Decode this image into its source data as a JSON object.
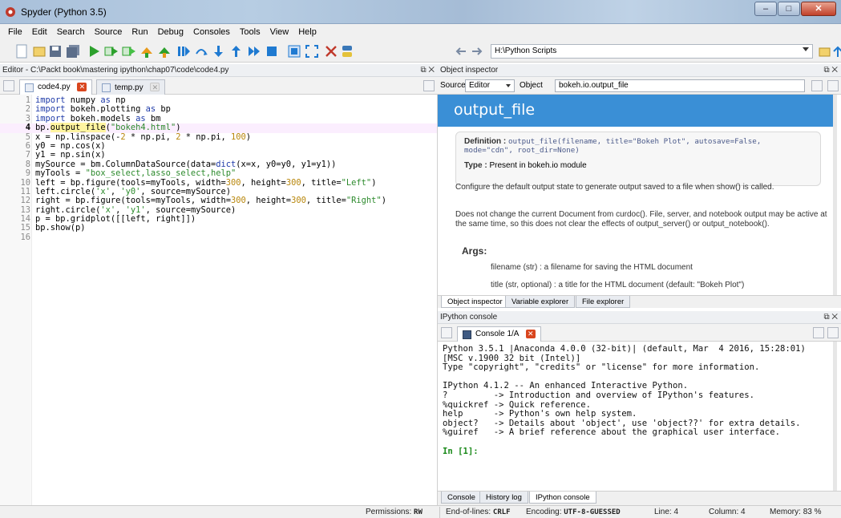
{
  "window": {
    "title": "Spyder (Python 3.5)"
  },
  "menu": [
    "File",
    "Edit",
    "Search",
    "Source",
    "Run",
    "Debug",
    "Consoles",
    "Tools",
    "View",
    "Help"
  ],
  "toolbar": {
    "path": "H:\\Python Scripts"
  },
  "editor": {
    "title": "Editor - C:\\Packt book\\mastering ipython\\chap07\\code\\code4.py",
    "tabs": [
      {
        "label": "code4.py",
        "active": true
      },
      {
        "label": "temp.py",
        "active": false
      }
    ],
    "current_line": 4
  },
  "code": [
    {
      "n": "1",
      "segs": [
        [
          "kw",
          "import"
        ],
        [
          "t",
          " numpy "
        ],
        [
          "kw",
          "as"
        ],
        [
          "t",
          " np"
        ]
      ]
    },
    {
      "n": "2",
      "segs": [
        [
          "kw",
          "import"
        ],
        [
          "t",
          " bokeh.plotting "
        ],
        [
          "kw",
          "as"
        ],
        [
          "t",
          " bp"
        ]
      ]
    },
    {
      "n": "3",
      "segs": [
        [
          "kw",
          "import"
        ],
        [
          "t",
          " bokeh.models "
        ],
        [
          "kw",
          "as"
        ],
        [
          "t",
          " bm"
        ]
      ]
    },
    {
      "n": "4",
      "segs": [
        [
          "t",
          "bp."
        ],
        [
          "hl",
          "output_file"
        ],
        [
          "t",
          "("
        ],
        [
          "str",
          "\"bokeh4.html\""
        ],
        [
          "t",
          ")"
        ]
      ]
    },
    {
      "n": "5",
      "segs": [
        [
          "t",
          "x = np.linspace(-"
        ],
        [
          "num",
          "2"
        ],
        [
          "t",
          " * np.pi, "
        ],
        [
          "num",
          "2"
        ],
        [
          "t",
          " * np.pi, "
        ],
        [
          "num",
          "100"
        ],
        [
          "t",
          ")"
        ]
      ]
    },
    {
      "n": "6",
      "segs": [
        [
          "t",
          "y0 = np.cos(x)"
        ]
      ]
    },
    {
      "n": "7",
      "segs": [
        [
          "t",
          "y1 = np.sin(x)"
        ]
      ]
    },
    {
      "n": "8",
      "segs": [
        [
          "t",
          "mySource = bm.ColumnDataSource(data="
        ],
        [
          "kw",
          "dict"
        ],
        [
          "t",
          "(x=x, y0=y0, y1=y1))"
        ]
      ]
    },
    {
      "n": "9",
      "segs": [
        [
          "t",
          "myTools = "
        ],
        [
          "str",
          "\"box_select,lasso_select,help\""
        ]
      ]
    },
    {
      "n": "10",
      "segs": [
        [
          "t",
          "left = bp.figure(tools=myTools, width="
        ],
        [
          "num",
          "300"
        ],
        [
          "t",
          ", height="
        ],
        [
          "num",
          "300"
        ],
        [
          "t",
          ", title="
        ],
        [
          "str",
          "\"Left\""
        ],
        [
          "t",
          ")"
        ]
      ]
    },
    {
      "n": "11",
      "segs": [
        [
          "t",
          "left.circle("
        ],
        [
          "str",
          "'x'"
        ],
        [
          "t",
          ", "
        ],
        [
          "str",
          "'y0'"
        ],
        [
          "t",
          ", source=mySource)"
        ]
      ]
    },
    {
      "n": "12",
      "segs": [
        [
          "t",
          "right = bp.figure(tools=myTools, width="
        ],
        [
          "num",
          "300"
        ],
        [
          "t",
          ", height="
        ],
        [
          "num",
          "300"
        ],
        [
          "t",
          ", title="
        ],
        [
          "str",
          "\"Right\""
        ],
        [
          "t",
          ")"
        ]
      ]
    },
    {
      "n": "13",
      "segs": [
        [
          "t",
          "right.circle("
        ],
        [
          "str",
          "'x'"
        ],
        [
          "t",
          ", "
        ],
        [
          "str",
          "'y1'"
        ],
        [
          "t",
          ", source=mySource)"
        ]
      ]
    },
    {
      "n": "14",
      "segs": [
        [
          "t",
          "p = bp.gridplot([[left, right]])"
        ]
      ]
    },
    {
      "n": "15",
      "segs": [
        [
          "t",
          "bp.show(p)"
        ]
      ]
    },
    {
      "n": "16",
      "segs": []
    }
  ],
  "object_inspector": {
    "title": "Object inspector",
    "source_label": "Source",
    "source_value": "Editor",
    "object_label": "Object",
    "object_value": "bokeh.io.output_file",
    "heading": "output_file",
    "definition_label": "Definition :",
    "definition": "output_file(filename, title=\"Bokeh Plot\", autosave=False, mode=\"cdn\", root_dir=None)",
    "type_label": "Type :",
    "type_value": "Present in bokeh.io module",
    "para1": "Configure the default output state to generate output saved to a file when show() is called.",
    "para2": "Does not change the current Document from curdoc(). File, server, and notebook output may be active at the same time, so this does not clear the effects of output_server() or output_notebook().",
    "args_heading": "Args:",
    "args": [
      "filename (str) : a filename for saving the HTML document",
      "title (str, optional) : a title for the HTML document (default: \"Bokeh Plot\")"
    ],
    "bottom_tabs": [
      "Object inspector",
      "Variable explorer",
      "File explorer"
    ]
  },
  "ipython": {
    "title": "IPython console",
    "tab": "Console 1/A",
    "lines": [
      "Python 3.5.1 |Anaconda 4.0.0 (32-bit)| (default, Mar  4 2016, 15:28:01)",
      "[MSC v.1900 32 bit (Intel)]",
      "Type \"copyright\", \"credits\" or \"license\" for more information.",
      "",
      "IPython 4.1.2 -- An enhanced Interactive Python.",
      "?         -> Introduction and overview of IPython's features.",
      "%quickref -> Quick reference.",
      "help      -> Python's own help system.",
      "object?   -> Details about 'object', use 'object??' for extra details.",
      "%guiref   -> A brief reference about the graphical user interface.",
      ""
    ],
    "prompt": "In [1]:",
    "bottom_tabs": [
      "Console",
      "History log",
      "IPython console"
    ]
  },
  "status": {
    "permissions_label": "Permissions:",
    "permissions": "RW",
    "eol_label": "End-of-lines:",
    "eol": "CRLF",
    "encoding_label": "Encoding:",
    "encoding": "UTF-8-GUESSED",
    "line_label": "Line:",
    "line": "4",
    "column_label": "Column:",
    "column": "4",
    "memory_label": "Memory:",
    "memory": "83 %"
  }
}
